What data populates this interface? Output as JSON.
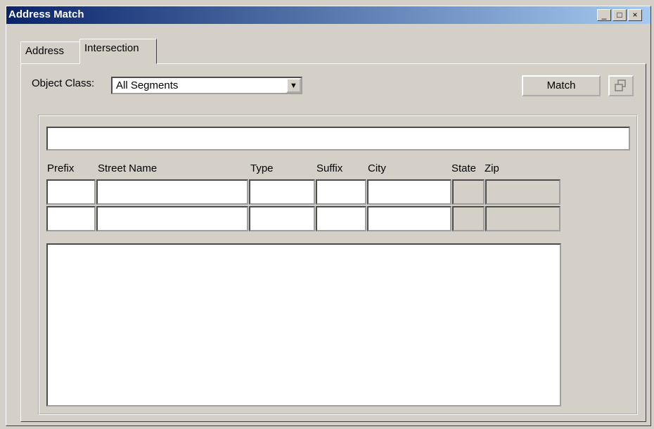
{
  "window": {
    "title": "Address Match",
    "minimize_icon": "minimize-icon",
    "maximize_icon": "maximize-icon",
    "close_icon": "close-icon"
  },
  "tabs": [
    {
      "label": "Address",
      "active": false
    },
    {
      "label": "Intersection",
      "active": true
    }
  ],
  "object_class": {
    "label": "Object Class:",
    "selected": "All Segments"
  },
  "buttons": {
    "match_label": "Match",
    "detach_icon": "window-restore-icon"
  },
  "fields": {
    "headers": [
      "Prefix",
      "Street Name",
      "Type",
      "Suffix",
      "City",
      "State",
      "Zip"
    ],
    "rows": [
      [
        "",
        "",
        "",
        "",
        "",
        "",
        ""
      ],
      [
        "",
        "",
        "",
        "",
        "",
        "",
        ""
      ]
    ]
  }
}
